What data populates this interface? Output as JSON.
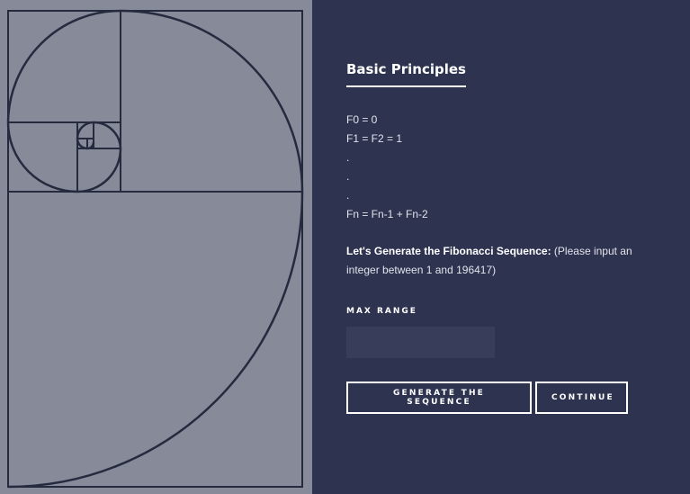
{
  "illustration": {
    "icon": "golden-spiral-icon",
    "background": "#868a99",
    "stroke": "#262a3f"
  },
  "panel": {
    "background": "#2e3350"
  },
  "content": {
    "title": "Basic Principles",
    "formulas": [
      "F0 = 0",
      "F1 = F2 = 1",
      ".",
      ".",
      ".",
      "Fn = Fn-1 + Fn-2"
    ],
    "prompt_bold": "Let's Generate the Fibonacci Sequence:",
    "prompt_rest": " (Please input an integer between 1 and 196417)",
    "max_range_label": "MAX RANGE",
    "max_range_value": "",
    "max_range_placeholder": ""
  },
  "buttons": {
    "generate_label": "GENERATE THE SEQUENCE",
    "continue_label": "CONTINUE"
  }
}
